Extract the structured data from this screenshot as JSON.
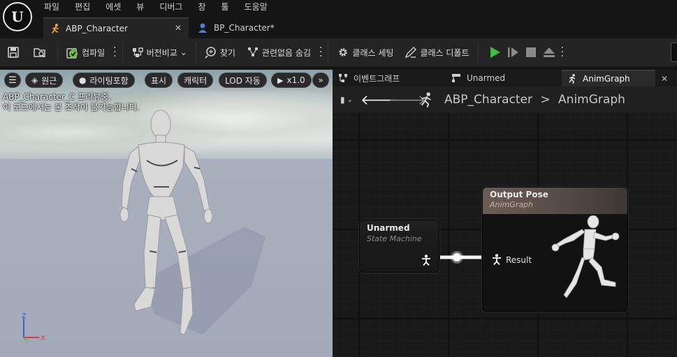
{
  "menu": {
    "items": [
      "파일",
      "편집",
      "에셋",
      "뷰",
      "디버그",
      "창",
      "툴",
      "도움말"
    ]
  },
  "tabs": [
    {
      "label": "ABP_Character",
      "active": true
    },
    {
      "label": "BP_Character*",
      "active": false
    }
  ],
  "toolbar": {
    "compile_label": "컴파일",
    "diff_label": "버전비교",
    "find_label": "찾기",
    "hide_unrelated_label": "관련없음 숨김",
    "class_settings_label": "클래스 세팅",
    "class_defaults_label": "클래스 디폴트"
  },
  "viewport": {
    "perspective_label": "원근",
    "lighting_label": "라이팅포함",
    "show_label": "표시",
    "character_label": "캐릭터",
    "lod_label": "LOD 자동",
    "speed_label": "x1.0",
    "overlay_line1": "ABP_Character_C 프리뷰중.",
    "overlay_line2": "이 모드에서는 본 조작이 불가능합니다.",
    "gizmo_labels": {
      "x": "X",
      "y": "Y",
      "z": "Z"
    }
  },
  "graph_tabs": [
    {
      "label": "이벤트그래프"
    },
    {
      "label": "Unarmed"
    },
    {
      "label": "AnimGraph",
      "active": true
    }
  ],
  "breadcrumb": {
    "root": "ABP_Character",
    "separator": ">",
    "current": "AnimGraph"
  },
  "nodes": {
    "unarmed": {
      "title": "Unarmed",
      "subtitle": "State Machine"
    },
    "output": {
      "title": "Output Pose",
      "subtitle": "AnimGraph",
      "pin_label": "Result"
    }
  },
  "colors": {
    "play": "#3fbd3f",
    "output_header": "#6b5d55",
    "compile_check": "#6cbf3a"
  }
}
